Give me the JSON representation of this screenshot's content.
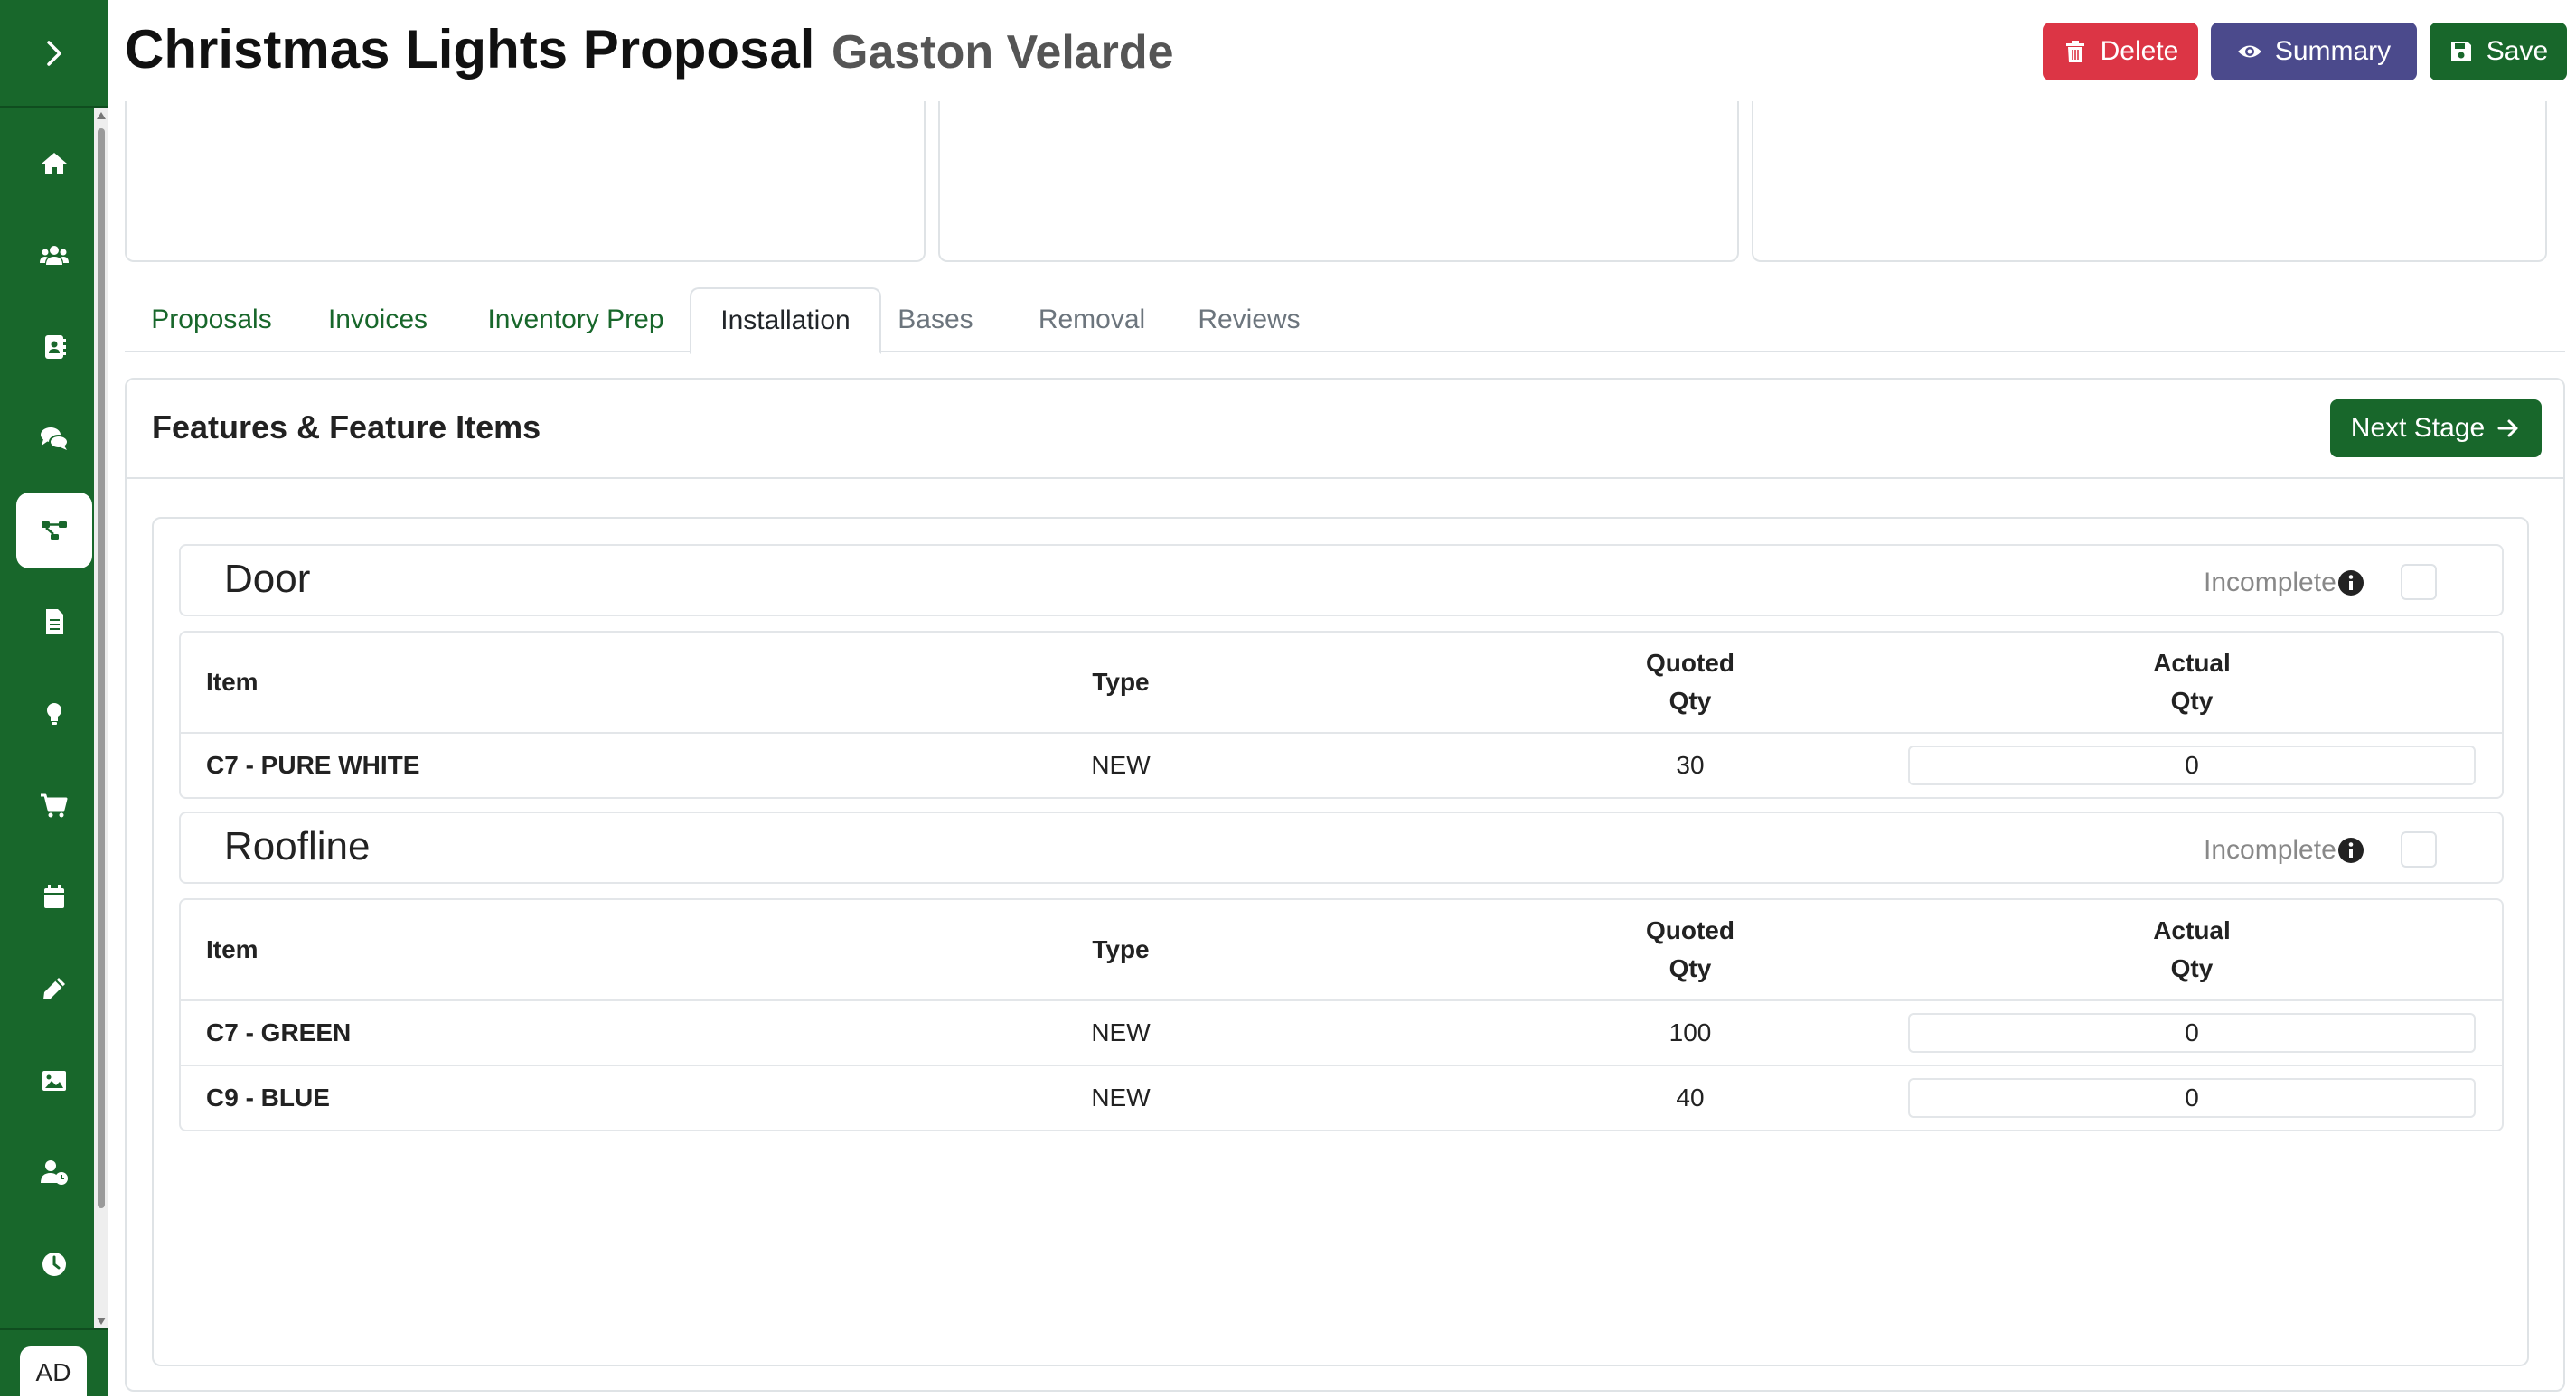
{
  "header": {
    "title": "Christmas Lights Proposal",
    "customer": "Gaston Velarde",
    "delete_label": "Delete",
    "summary_label": "Summary",
    "save_label": "Save"
  },
  "sidebar": {
    "toggle_icon": "chevron-right-icon",
    "items": [
      {
        "icon": "home-icon",
        "active": false
      },
      {
        "icon": "users-icon",
        "active": false
      },
      {
        "icon": "address-book-icon",
        "active": false
      },
      {
        "icon": "comments-icon",
        "active": false
      },
      {
        "icon": "workflow-icon",
        "active": true
      },
      {
        "icon": "document-icon",
        "active": false
      },
      {
        "icon": "lightbulb-icon",
        "active": false
      },
      {
        "icon": "cart-icon",
        "active": false
      },
      {
        "icon": "calendar-icon",
        "active": false
      },
      {
        "icon": "pencil-icon",
        "active": false
      },
      {
        "icon": "image-icon",
        "active": false
      },
      {
        "icon": "user-clock-icon",
        "active": false
      },
      {
        "icon": "clock-icon",
        "active": false
      }
    ],
    "user_initials": "AD"
  },
  "tabs": [
    {
      "label": "Proposals",
      "state": "link"
    },
    {
      "label": "Invoices",
      "state": "link"
    },
    {
      "label": "Inventory Prep",
      "state": "link"
    },
    {
      "label": "Installation",
      "state": "active"
    },
    {
      "label": "Bases",
      "state": "disabled"
    },
    {
      "label": "Removal",
      "state": "disabled"
    },
    {
      "label": "Reviews",
      "state": "disabled"
    }
  ],
  "panel": {
    "title": "Features & Feature Items",
    "next_stage_label": "Next Stage"
  },
  "columns": {
    "item": "Item",
    "type": "Type",
    "quoted_qty_1": "Quoted",
    "quoted_qty_2": "Qty",
    "actual_qty_1": "Actual",
    "actual_qty_2": "Qty"
  },
  "features": [
    {
      "name": "Door",
      "status": "Incomplete",
      "complete": false,
      "items": [
        {
          "item": "C7 - PURE WHITE",
          "type": "NEW",
          "quoted_qty": "30",
          "actual_qty": "0"
        }
      ]
    },
    {
      "name": "Roofline",
      "status": "Incomplete",
      "complete": false,
      "items": [
        {
          "item": "C7 - GREEN",
          "type": "NEW",
          "quoted_qty": "100",
          "actual_qty": "0"
        },
        {
          "item": "C9 - BLUE",
          "type": "NEW",
          "quoted_qty": "40",
          "actual_qty": "0"
        }
      ]
    }
  ],
  "colors": {
    "brand_green": "#18672b",
    "delete_red": "#dc3545",
    "summary_purple": "#4b4a8c"
  }
}
